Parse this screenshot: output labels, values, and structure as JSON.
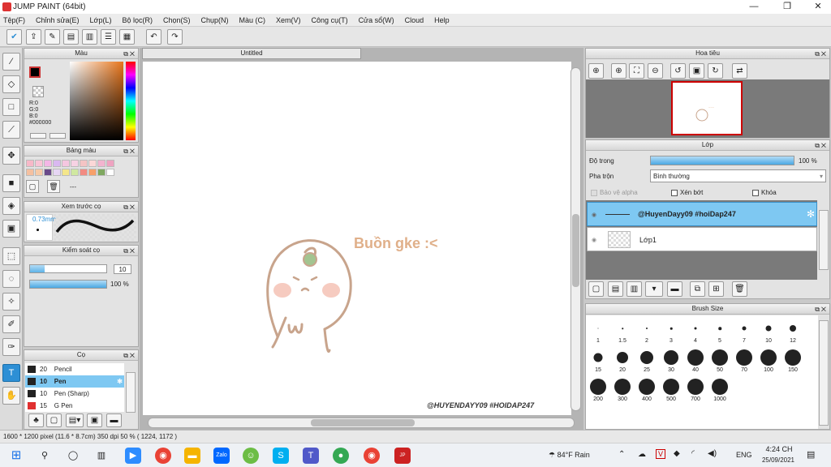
{
  "window": {
    "title": "JUMP PAINT (64bit)",
    "controls": [
      "—",
      "❐",
      "✕"
    ]
  },
  "menu": [
    "Tệp(F)",
    "Chỉnh sửa(E)",
    "Lớp(L)",
    "Bộ lọc(R)",
    "Chọn(S)",
    "Chụp(N)",
    "Màu (C)",
    "Xem(V)",
    "Công cụ(T)",
    "Cửa sổ(W)",
    "Cloud",
    "Help"
  ],
  "color_panel": {
    "title": "Màu",
    "r": "R:0",
    "g": "G:0",
    "b": "B:0",
    "hex": "#000000"
  },
  "palette_panel": {
    "title": "Bảng màu",
    "dash": "---"
  },
  "brush_preview": {
    "title": "Xem trước cọ",
    "size": "0.73mm"
  },
  "brush_control": {
    "title": "Kiểm soát cọ",
    "size_value": "10",
    "opacity_value": "100 %"
  },
  "brush_list": {
    "title": "Cọ",
    "items": [
      {
        "size": "20",
        "name": "Pencil",
        "color": "#222222"
      },
      {
        "size": "10",
        "name": "Pen",
        "color": "#222222"
      },
      {
        "size": "10",
        "name": "Pen (Sharp)",
        "color": "#222222"
      },
      {
        "size": "15",
        "name": "G Pen",
        "color": "#e03030"
      }
    ]
  },
  "canvas": {
    "tab": "Untitled",
    "drawing_text": "Buồn gke :<",
    "signature": "@HUYENDAYY09 #HOIDAP247"
  },
  "navigator": {
    "title": "Hoa tiêu"
  },
  "layer_panel": {
    "title": "Lớp",
    "opacity_label": "Độ trong",
    "opacity_value": "100 %",
    "blend_label": "Pha trộn",
    "blend_value": "Bình thường",
    "protect_alpha": "Bảo vệ alpha",
    "clip": "Xén bớt",
    "lock": "Khóa",
    "layers": [
      {
        "name": "@HuyenDayy09 #hoiDap247"
      },
      {
        "name": "Lớp1"
      }
    ]
  },
  "brush_size_panel": {
    "title": "Brush Size",
    "sizes": [
      "1",
      "1.5",
      "2",
      "3",
      "4",
      "5",
      "7",
      "10",
      "12",
      "15",
      "20",
      "25",
      "30",
      "40",
      "50",
      "70",
      "100",
      "150",
      "200",
      "300",
      "400",
      "500",
      "700",
      "1000"
    ]
  },
  "status": {
    "text": "1600 * 1200 pixel   (11.6 * 8.7cm)   350 dpi   50 %   ( 1224, 1172 )"
  },
  "taskbar": {
    "weather": "84°F  Rain",
    "lang": "ENG",
    "time": "4:24 CH",
    "date": "25/09/2021"
  },
  "colors": {
    "accent": "#2d8fd5",
    "layer_selected": "#7ec8f2",
    "drawing": "#c8a48c"
  }
}
